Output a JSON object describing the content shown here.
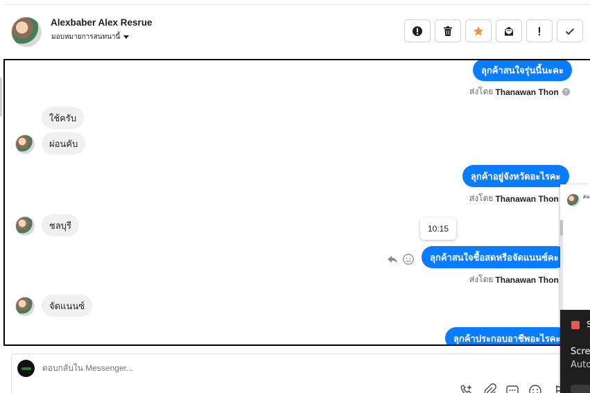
{
  "header": {
    "contact_name": "Alexbaber Alex Resrue",
    "assign_label": "มอบหมายการสนทนานี้"
  },
  "toolbar": [
    {
      "name": "report-spam-button",
      "icon": "alert-circle-icon"
    },
    {
      "name": "delete-button",
      "icon": "trash-icon"
    },
    {
      "name": "star-button",
      "icon": "star-icon",
      "color": "#f7923a"
    },
    {
      "name": "mark-unread-button",
      "icon": "mail-icon"
    },
    {
      "name": "follow-up-button",
      "icon": "exclamation-icon"
    },
    {
      "name": "mark-done-button",
      "icon": "check-icon"
    }
  ],
  "messages": {
    "m1": "ลุกค้าสนใจรุ่นนี้นะคะ",
    "m2": "ใช้ครับ",
    "m3": "ผ่อนคับ",
    "m4": "ลุกค้าอยู่จังหวัดอะไรคะ",
    "m5": "ชลบุรี",
    "m6": "ลุกค้าสนใจซื้อสดหรือจัดแนนซ์คะ",
    "m7": "จัดแนนซ์",
    "m8": "ลุกค้าประกอบอาชีพอะไรคะ"
  },
  "sent_by": {
    "prefix": "ส่งโดย",
    "agent": "Thanawan Thon",
    "help_glyph": "?"
  },
  "tooltip_time": "10:15",
  "reply": {
    "placeholder": "ตอบกลับใน Messenger..."
  },
  "overlay": {
    "mini_name": "Ale",
    "panel_title": "S",
    "panel_line1": "Scre",
    "panel_line2": "Auto"
  },
  "colors": {
    "accent": "#0a7cff",
    "star": "#f7923a"
  }
}
